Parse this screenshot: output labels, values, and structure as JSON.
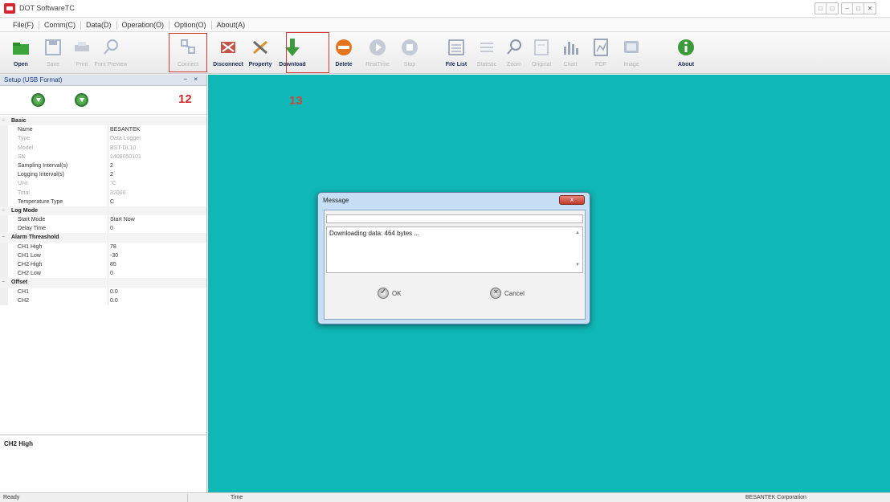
{
  "window": {
    "title": "DOT SoftwareTC",
    "controls": [
      "min",
      "max",
      "close"
    ]
  },
  "menubar": {
    "items": [
      "File(F)",
      "Comm(C)",
      "Data(D)",
      "Operation(O)",
      "Option(O)",
      "About(A)"
    ]
  },
  "toolbar": {
    "buttons": [
      {
        "id": "open",
        "label": "Open",
        "icon": "folder-icon",
        "enabled": true
      },
      {
        "id": "save",
        "label": "Save",
        "icon": "save-icon",
        "enabled": false
      },
      {
        "id": "print",
        "label": "Print",
        "icon": "print-icon",
        "enabled": false
      },
      {
        "id": "print-preview",
        "label": "Print Preview",
        "icon": "magnifier-icon",
        "enabled": false
      },
      {
        "id": "connect",
        "label": "Connect",
        "icon": "connect-icon",
        "enabled": false
      },
      {
        "id": "disconnect",
        "label": "Disconnect",
        "icon": "disconnect-icon",
        "enabled": true
      },
      {
        "id": "property",
        "label": "Property",
        "icon": "tools-icon",
        "enabled": true
      },
      {
        "id": "download",
        "label": "Download",
        "icon": "download-arrow-icon",
        "enabled": true
      },
      {
        "id": "delete",
        "label": "Delete",
        "icon": "delete-icon",
        "enabled": true
      },
      {
        "id": "realtime",
        "label": "RealTime",
        "icon": "play-icon",
        "enabled": false
      },
      {
        "id": "stop",
        "label": "Stop",
        "icon": "stop-icon",
        "enabled": false
      },
      {
        "id": "file-list",
        "label": "File List",
        "icon": "file-list-icon",
        "enabled": true
      },
      {
        "id": "statistics",
        "label": "Statistic",
        "icon": "table-icon",
        "enabled": false
      },
      {
        "id": "zoom",
        "label": "Zoom",
        "icon": "zoom-icon",
        "enabled": false
      },
      {
        "id": "original",
        "label": "Original",
        "icon": "original-icon",
        "enabled": false
      },
      {
        "id": "chart",
        "label": "Chart",
        "icon": "bar-chart-icon",
        "enabled": false
      },
      {
        "id": "pdf",
        "label": "PDF",
        "icon": "pdf-icon",
        "enabled": false
      },
      {
        "id": "image",
        "label": "Image",
        "icon": "image-icon",
        "enabled": false
      },
      {
        "id": "about",
        "label": "About",
        "icon": "info-icon",
        "enabled": true
      }
    ]
  },
  "annotations": {
    "step12": "12",
    "step13": "13"
  },
  "left_panel": {
    "title": "Setup (USB Format)",
    "pin_controls": "− ×",
    "properties": [
      {
        "type": "category",
        "name": "Basic"
      },
      {
        "type": "prop",
        "name": "Name",
        "value": "BESANTEK",
        "dim": false
      },
      {
        "type": "prop",
        "name": "Type",
        "value": "Data Logger",
        "dim": true
      },
      {
        "type": "prop",
        "name": "Model",
        "value": "BST-DL10",
        "dim": true
      },
      {
        "type": "prop",
        "name": "SN",
        "value": "1409050101",
        "dim": true
      },
      {
        "type": "prop",
        "name": "Sampling Interval(s)",
        "value": "2",
        "dim": false
      },
      {
        "type": "prop",
        "name": "Logging Interval(s)",
        "value": "2",
        "dim": false
      },
      {
        "type": "prop",
        "name": "Unit",
        "value": "°C",
        "dim": true
      },
      {
        "type": "prop",
        "name": "Total",
        "value": "32000",
        "dim": true
      },
      {
        "type": "prop",
        "name": "Temperature Type",
        "value": "C",
        "dim": false
      },
      {
        "type": "category",
        "name": "Log Mode"
      },
      {
        "type": "prop",
        "name": "Start Mode",
        "value": "Start Now",
        "dim": false
      },
      {
        "type": "prop",
        "name": "Delay Time",
        "value": "0",
        "dim": false
      },
      {
        "type": "category",
        "name": "Alarm Threashold"
      },
      {
        "type": "prop",
        "name": "CH1 High",
        "value": "78",
        "dim": false
      },
      {
        "type": "prop",
        "name": "CH1 Low",
        "value": "-30",
        "dim": false
      },
      {
        "type": "prop",
        "name": "CH2 High",
        "value": "85",
        "dim": false
      },
      {
        "type": "prop",
        "name": "CH2 Low",
        "value": "0",
        "dim": false
      },
      {
        "type": "category",
        "name": "Offset"
      },
      {
        "type": "prop",
        "name": "CH1",
        "value": "0.0",
        "dim": false
      },
      {
        "type": "prop",
        "name": "CH2",
        "value": "0.0",
        "dim": false
      }
    ],
    "description_title": "CH2 High"
  },
  "dialog": {
    "title": "Message",
    "close_label": "x",
    "message": "Downloading data: 464 bytes ...",
    "ok_label": "OK",
    "cancel_label": "Cancel"
  },
  "statusbar": {
    "left": "Ready",
    "time": "Time",
    "right": "BESANTEK Corporation"
  }
}
